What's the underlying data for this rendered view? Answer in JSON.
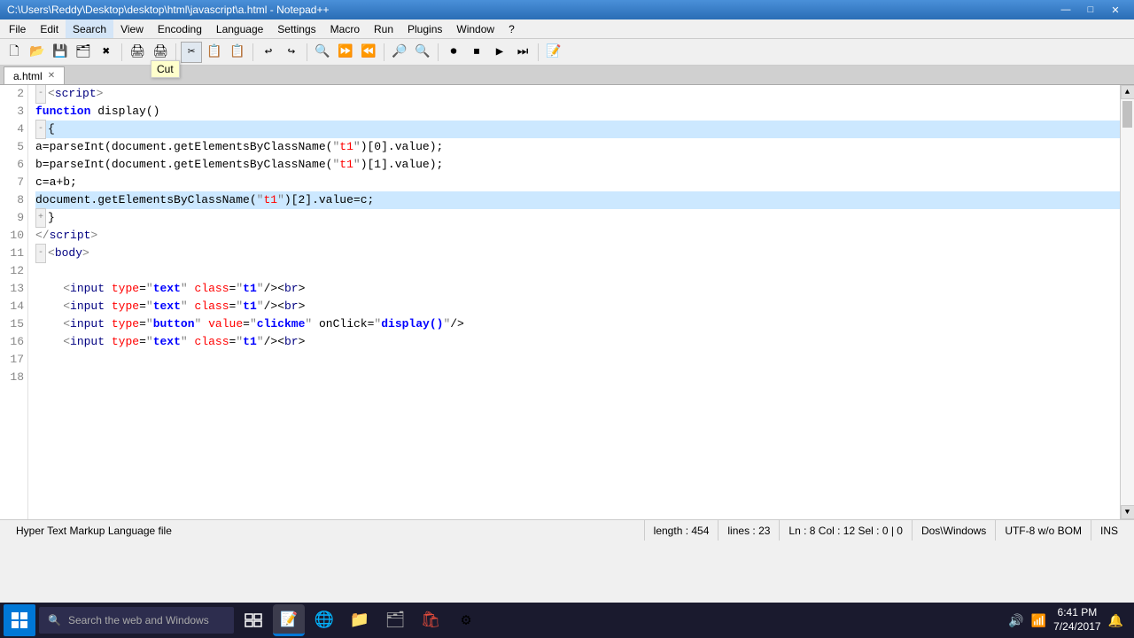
{
  "titlebar": {
    "title": "C:\\Users\\Reddy\\Desktop\\desktop\\html\\javascript\\a.html - Notepad++",
    "minimize": "—",
    "maximize": "□",
    "close": "✕"
  },
  "menubar": {
    "items": [
      "File",
      "Edit",
      "Search",
      "View",
      "Encoding",
      "Language",
      "Settings",
      "Macro",
      "Run",
      "Plugins",
      "Window",
      "?"
    ]
  },
  "toolbar": {
    "buttons": [
      "📄",
      "📂",
      "💾",
      "🖨",
      "✂",
      "📋",
      "📋",
      "↩",
      "↪",
      "🔍",
      "🔍",
      "🔍",
      "🔍",
      "🔍",
      "🔍",
      "🔍",
      "🔍",
      "🔍",
      "🔍"
    ]
  },
  "tooltip": {
    "text": "Cut"
  },
  "tab": {
    "label": "a.html",
    "close": "✕"
  },
  "lines": [
    {
      "num": 2,
      "content": "",
      "type": "tag_line",
      "raw": "<script>"
    },
    {
      "num": 3,
      "content": "",
      "type": "function_line"
    },
    {
      "num": 4,
      "content": "",
      "type": "open_brace",
      "highlighted": true
    },
    {
      "num": 5,
      "content": "",
      "type": "code"
    },
    {
      "num": 6,
      "content": "",
      "type": "code"
    },
    {
      "num": 7,
      "content": "",
      "type": "code2"
    },
    {
      "num": 8,
      "content": "",
      "type": "code3",
      "highlighted": true
    },
    {
      "num": 9,
      "content": "",
      "type": "close_brace"
    },
    {
      "num": 10,
      "content": "",
      "type": "close_script"
    },
    {
      "num": 11,
      "content": "",
      "type": "body_tag"
    },
    {
      "num": 12,
      "content": "",
      "type": "empty"
    },
    {
      "num": 13,
      "content": "",
      "type": "input1"
    },
    {
      "num": 14,
      "content": "",
      "type": "input2"
    },
    {
      "num": 15,
      "content": "",
      "type": "button_input"
    },
    {
      "num": 16,
      "content": "",
      "type": "input3"
    },
    {
      "num": 17,
      "content": "",
      "type": "empty2"
    },
    {
      "num": 18,
      "content": "",
      "type": "empty3"
    }
  ],
  "statusbar": {
    "filetype": "Hyper Text Markup Language file",
    "length": "length : 454",
    "lines": "lines : 23",
    "position": "Ln : 8   Col : 12   Sel : 0 | 0",
    "encoding_dos": "Dos\\Windows",
    "encoding": "UTF-8 w/o BOM",
    "ins": "INS"
  },
  "taskbar": {
    "search_placeholder": "Search the web and Windows",
    "time": "6:41 PM",
    "date": "7/24/2017",
    "active_app": "Notepad++"
  }
}
